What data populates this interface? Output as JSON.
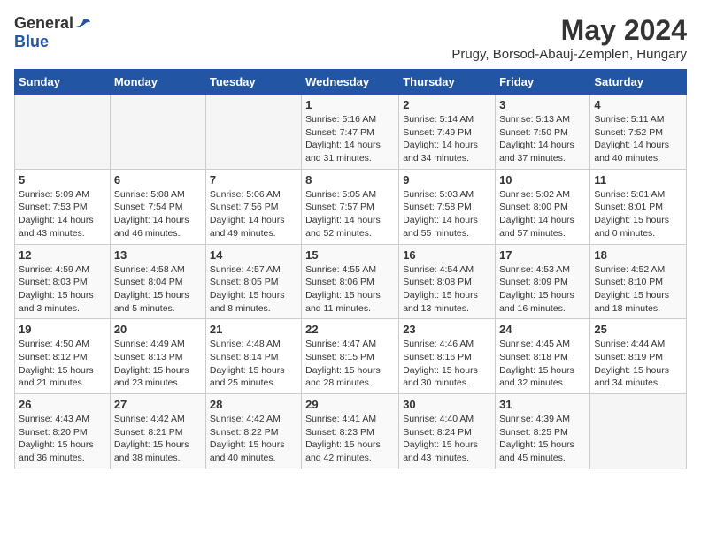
{
  "header": {
    "logo_general": "General",
    "logo_blue": "Blue",
    "title": "May 2024",
    "subtitle": "Prugy, Borsod-Abauj-Zemplen, Hungary"
  },
  "calendar": {
    "weekdays": [
      "Sunday",
      "Monday",
      "Tuesday",
      "Wednesday",
      "Thursday",
      "Friday",
      "Saturday"
    ],
    "weeks": [
      [
        {
          "day": "",
          "info": ""
        },
        {
          "day": "",
          "info": ""
        },
        {
          "day": "",
          "info": ""
        },
        {
          "day": "1",
          "info": "Sunrise: 5:16 AM\nSunset: 7:47 PM\nDaylight: 14 hours\nand 31 minutes."
        },
        {
          "day": "2",
          "info": "Sunrise: 5:14 AM\nSunset: 7:49 PM\nDaylight: 14 hours\nand 34 minutes."
        },
        {
          "day": "3",
          "info": "Sunrise: 5:13 AM\nSunset: 7:50 PM\nDaylight: 14 hours\nand 37 minutes."
        },
        {
          "day": "4",
          "info": "Sunrise: 5:11 AM\nSunset: 7:52 PM\nDaylight: 14 hours\nand 40 minutes."
        }
      ],
      [
        {
          "day": "5",
          "info": "Sunrise: 5:09 AM\nSunset: 7:53 PM\nDaylight: 14 hours\nand 43 minutes."
        },
        {
          "day": "6",
          "info": "Sunrise: 5:08 AM\nSunset: 7:54 PM\nDaylight: 14 hours\nand 46 minutes."
        },
        {
          "day": "7",
          "info": "Sunrise: 5:06 AM\nSunset: 7:56 PM\nDaylight: 14 hours\nand 49 minutes."
        },
        {
          "day": "8",
          "info": "Sunrise: 5:05 AM\nSunset: 7:57 PM\nDaylight: 14 hours\nand 52 minutes."
        },
        {
          "day": "9",
          "info": "Sunrise: 5:03 AM\nSunset: 7:58 PM\nDaylight: 14 hours\nand 55 minutes."
        },
        {
          "day": "10",
          "info": "Sunrise: 5:02 AM\nSunset: 8:00 PM\nDaylight: 14 hours\nand 57 minutes."
        },
        {
          "day": "11",
          "info": "Sunrise: 5:01 AM\nSunset: 8:01 PM\nDaylight: 15 hours\nand 0 minutes."
        }
      ],
      [
        {
          "day": "12",
          "info": "Sunrise: 4:59 AM\nSunset: 8:03 PM\nDaylight: 15 hours\nand 3 minutes."
        },
        {
          "day": "13",
          "info": "Sunrise: 4:58 AM\nSunset: 8:04 PM\nDaylight: 15 hours\nand 5 minutes."
        },
        {
          "day": "14",
          "info": "Sunrise: 4:57 AM\nSunset: 8:05 PM\nDaylight: 15 hours\nand 8 minutes."
        },
        {
          "day": "15",
          "info": "Sunrise: 4:55 AM\nSunset: 8:06 PM\nDaylight: 15 hours\nand 11 minutes."
        },
        {
          "day": "16",
          "info": "Sunrise: 4:54 AM\nSunset: 8:08 PM\nDaylight: 15 hours\nand 13 minutes."
        },
        {
          "day": "17",
          "info": "Sunrise: 4:53 AM\nSunset: 8:09 PM\nDaylight: 15 hours\nand 16 minutes."
        },
        {
          "day": "18",
          "info": "Sunrise: 4:52 AM\nSunset: 8:10 PM\nDaylight: 15 hours\nand 18 minutes."
        }
      ],
      [
        {
          "day": "19",
          "info": "Sunrise: 4:50 AM\nSunset: 8:12 PM\nDaylight: 15 hours\nand 21 minutes."
        },
        {
          "day": "20",
          "info": "Sunrise: 4:49 AM\nSunset: 8:13 PM\nDaylight: 15 hours\nand 23 minutes."
        },
        {
          "day": "21",
          "info": "Sunrise: 4:48 AM\nSunset: 8:14 PM\nDaylight: 15 hours\nand 25 minutes."
        },
        {
          "day": "22",
          "info": "Sunrise: 4:47 AM\nSunset: 8:15 PM\nDaylight: 15 hours\nand 28 minutes."
        },
        {
          "day": "23",
          "info": "Sunrise: 4:46 AM\nSunset: 8:16 PM\nDaylight: 15 hours\nand 30 minutes."
        },
        {
          "day": "24",
          "info": "Sunrise: 4:45 AM\nSunset: 8:18 PM\nDaylight: 15 hours\nand 32 minutes."
        },
        {
          "day": "25",
          "info": "Sunrise: 4:44 AM\nSunset: 8:19 PM\nDaylight: 15 hours\nand 34 minutes."
        }
      ],
      [
        {
          "day": "26",
          "info": "Sunrise: 4:43 AM\nSunset: 8:20 PM\nDaylight: 15 hours\nand 36 minutes."
        },
        {
          "day": "27",
          "info": "Sunrise: 4:42 AM\nSunset: 8:21 PM\nDaylight: 15 hours\nand 38 minutes."
        },
        {
          "day": "28",
          "info": "Sunrise: 4:42 AM\nSunset: 8:22 PM\nDaylight: 15 hours\nand 40 minutes."
        },
        {
          "day": "29",
          "info": "Sunrise: 4:41 AM\nSunset: 8:23 PM\nDaylight: 15 hours\nand 42 minutes."
        },
        {
          "day": "30",
          "info": "Sunrise: 4:40 AM\nSunset: 8:24 PM\nDaylight: 15 hours\nand 43 minutes."
        },
        {
          "day": "31",
          "info": "Sunrise: 4:39 AM\nSunset: 8:25 PM\nDaylight: 15 hours\nand 45 minutes."
        },
        {
          "day": "",
          "info": ""
        }
      ]
    ]
  }
}
